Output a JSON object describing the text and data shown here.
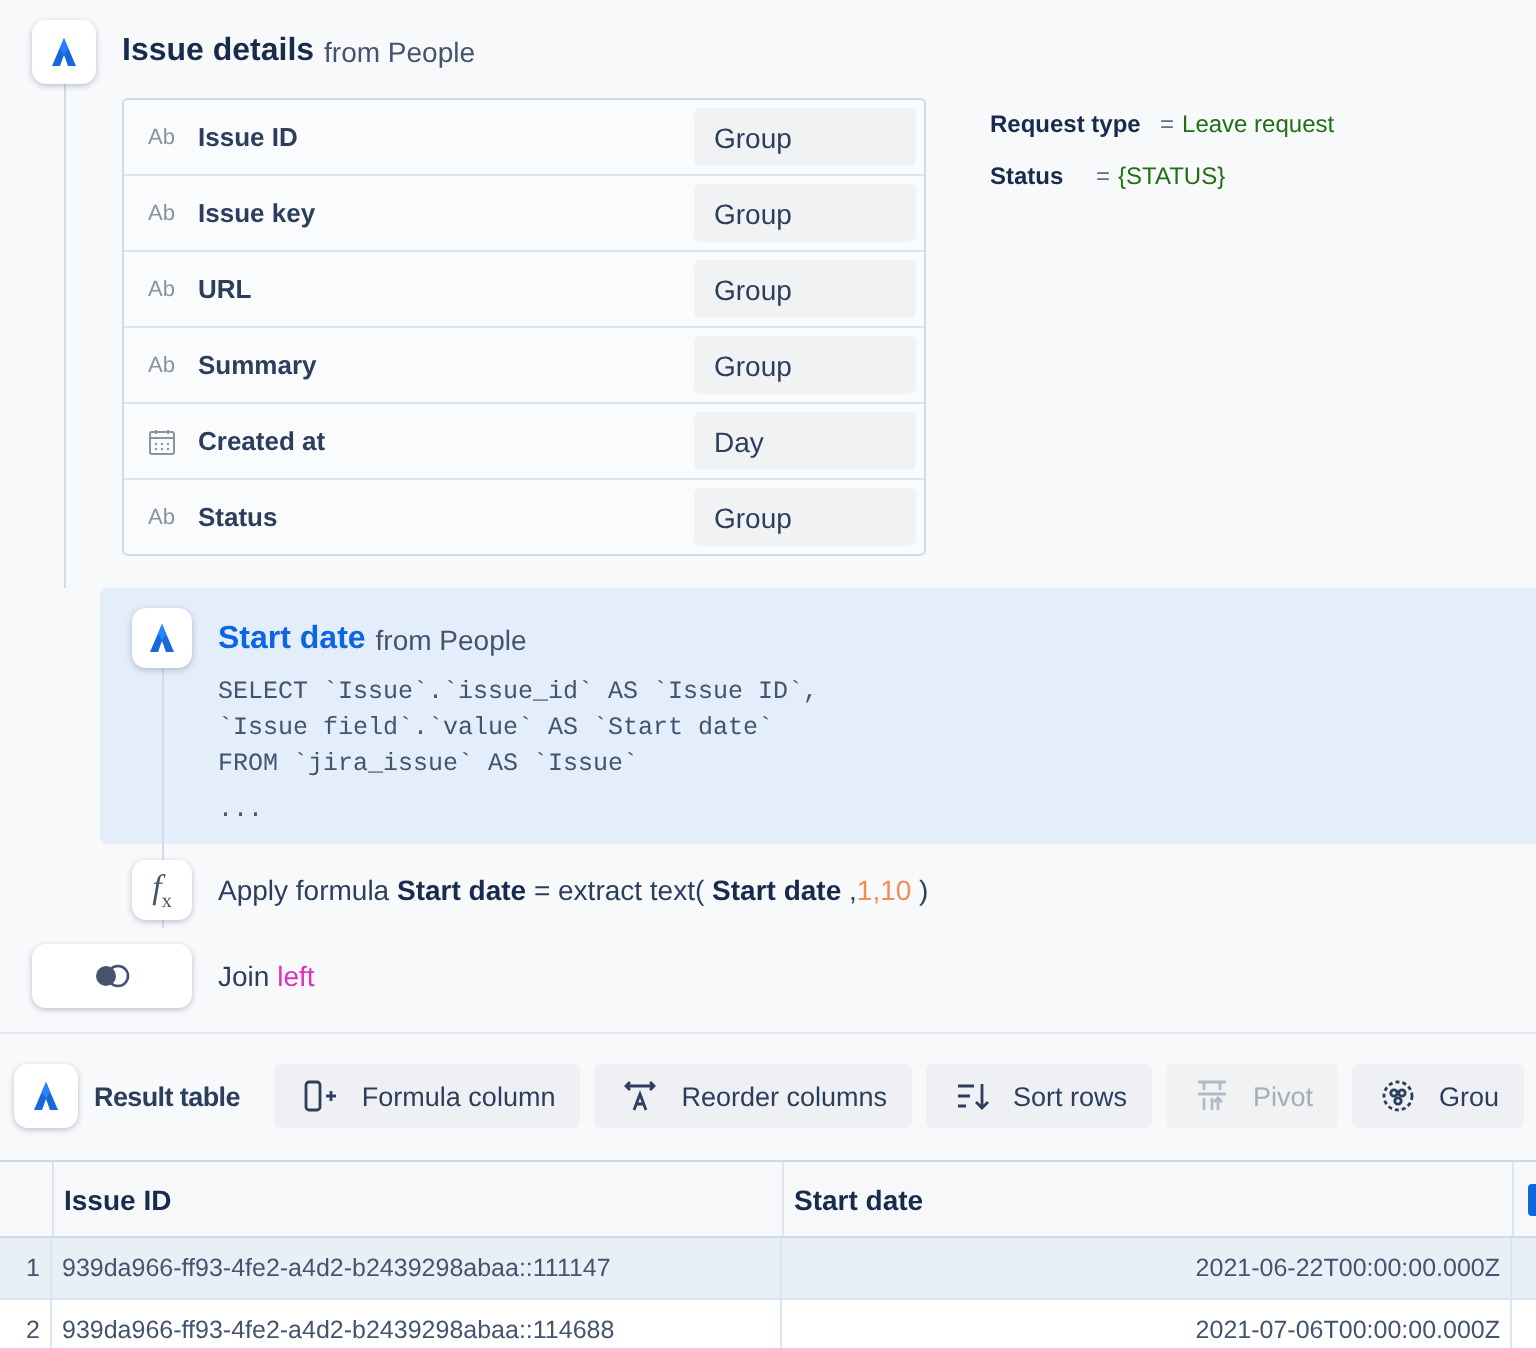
{
  "source_step": {
    "title": "Issue details",
    "source": "from People",
    "fields": [
      {
        "kind": "text",
        "type_label": "Ab",
        "name": "Issue ID",
        "grouping": "Group"
      },
      {
        "kind": "text",
        "type_label": "Ab",
        "name": "Issue key",
        "grouping": "Group"
      },
      {
        "kind": "text",
        "type_label": "Ab",
        "name": "URL",
        "grouping": "Group"
      },
      {
        "kind": "text",
        "type_label": "Ab",
        "name": "Summary",
        "grouping": "Group"
      },
      {
        "kind": "date",
        "name": "Created at",
        "grouping": "Day"
      },
      {
        "kind": "text",
        "type_label": "Ab",
        "name": "Status",
        "grouping": "Group"
      }
    ],
    "filters": [
      {
        "field": "Request type",
        "operator": "=",
        "value": "Leave request"
      },
      {
        "field": "Status",
        "operator": "=",
        "value": "{STATUS}"
      }
    ]
  },
  "query_step": {
    "title": "Start date",
    "source": "from People",
    "selected": true,
    "sql": [
      "SELECT `Issue`.`issue_id` AS `Issue ID`,",
      "`Issue field`.`value` AS `Start date`",
      "FROM `jira_issue` AS `Issue`",
      "..."
    ]
  },
  "formula_step": {
    "icon": "*f*$_{x}$",
    "parts": [
      {
        "kind": "plain",
        "text": "Apply formula"
      },
      {
        "kind": "field",
        "text": "Start date"
      },
      {
        "kind": "plain",
        "text": "= extract text("
      },
      {
        "kind": "field",
        "text": "Start date"
      },
      {
        "kind": "number",
        "separator": ",",
        "text": "1,10"
      },
      {
        "kind": "plain",
        "text": ")"
      }
    ]
  },
  "join_step": {
    "label": "Join",
    "type": "left"
  },
  "toolbar": {
    "title": "Result table",
    "buttons": [
      {
        "kind": "formula",
        "label": "Formula column",
        "disabled": false
      },
      {
        "kind": "reorder",
        "label": "Reorder columns",
        "disabled": false
      },
      {
        "kind": "sort",
        "label": "Sort rows",
        "disabled": false
      },
      {
        "kind": "pivot",
        "label": "Pivot",
        "disabled": true
      },
      {
        "kind": "group",
        "label": "Grou",
        "disabled": false
      }
    ]
  },
  "table": {
    "columns": [
      "Issue ID",
      "Start date"
    ],
    "rows": [
      {
        "index": "1",
        "cells": [
          "939da966-ff93-4fe2-a4d2-b2439298abaa::111147",
          "2021-06-22T00:00:00.000Z"
        ],
        "selected": true
      },
      {
        "index": "2",
        "cells": [
          "939da966-ff93-4fe2-a4d2-b2439298abaa::114688",
          "2021-07-06T00:00:00.000Z"
        ],
        "selected": false
      }
    ]
  }
}
